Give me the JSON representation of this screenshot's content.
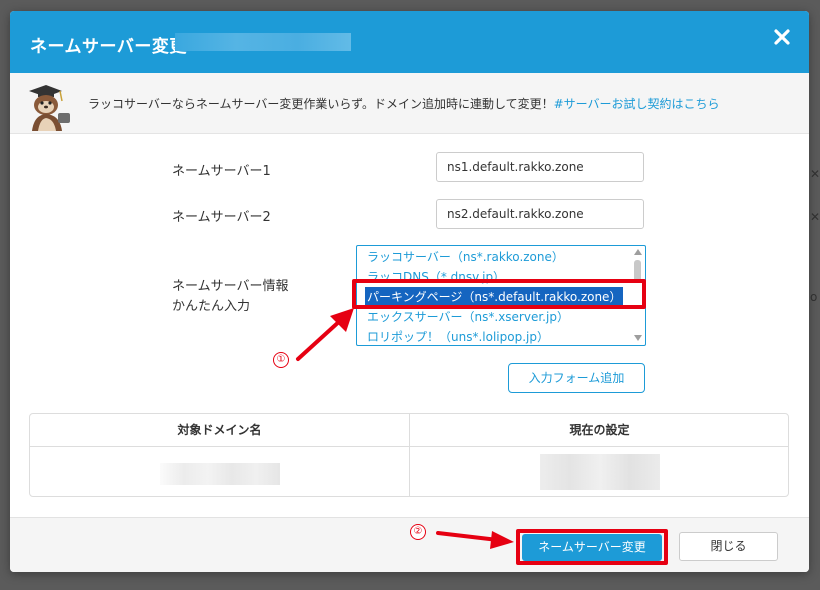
{
  "modal": {
    "title": "ネームサーバー変更",
    "close_icon": "close-icon"
  },
  "promo": {
    "text": "ラッコサーバーならネームサーバー変更作業いらず。ドメイン追加時に連動して変更！",
    "link": "#サーバーお試し契約はこちら"
  },
  "form": {
    "ns1_label": "ネームサーバー1",
    "ns1_value": "ns1.default.rakko.zone",
    "ns2_label": "ネームサーバー2",
    "ns2_value": "ns2.default.rakko.zone",
    "info_label_line1": "ネームサーバー情報",
    "info_label_line2": "かんたん入力",
    "options": [
      "ラッコサーバー（ns*.rakko.zone）",
      "ラッコDNS（*.dnsv.jp）",
      "パーキングページ（ns*.default.rakko.zone）",
      "エックスサーバー（ns*.xserver.jp）",
      "ロリポップ！（uns*.lolipop.jp）"
    ],
    "selected_option": "パーキングページ（ns*.default.rakko.zone）",
    "add_form_label": "入力フォーム追加"
  },
  "table": {
    "headers": [
      "対象ドメイン名",
      "現在の設定"
    ]
  },
  "footer": {
    "submit_label": "ネームサーバー変更",
    "close_label": "閉じる"
  },
  "annotations": {
    "step1": "①",
    "step2": "②"
  },
  "colors": {
    "primary": "#1d9bd7",
    "highlight": "#e60012",
    "selected_bg": "#1565c0"
  }
}
